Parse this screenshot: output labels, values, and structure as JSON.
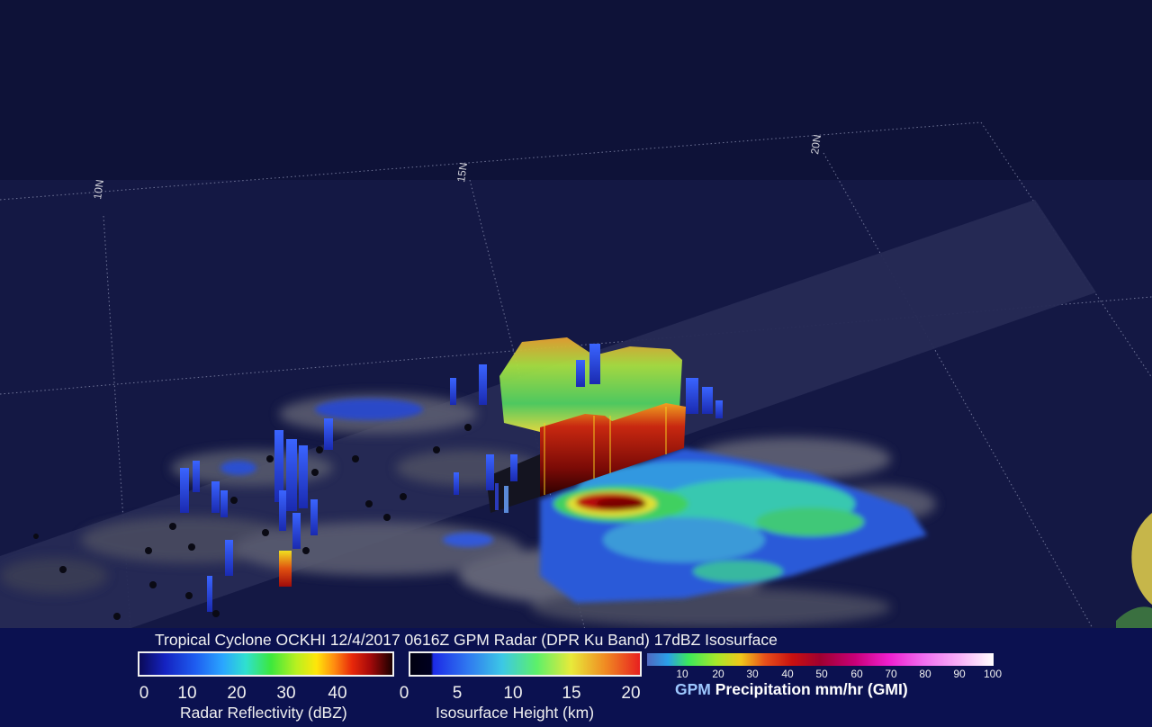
{
  "scene": {
    "latitude_labels": [
      "10N",
      "15N",
      "20N"
    ],
    "surface_colors": {
      "ocean": "#15184a",
      "swath": "#26294f",
      "land": "#c6b64a"
    }
  },
  "legend": {
    "title": "Tropical Cyclone OCKHI 12/4/2017 0616Z GPM Radar (DPR Ku Band) 17dBZ Isosurface",
    "reflectivity": {
      "ticks": [
        "0",
        "10",
        "20",
        "30",
        "40"
      ],
      "label": "Radar Reflectivity (dBZ)"
    },
    "isosurface": {
      "ticks": [
        "0",
        "5",
        "10",
        "15",
        "20"
      ],
      "label": "Isosurface Height (km)"
    },
    "precipitation": {
      "ticks": [
        "10",
        "20",
        "30",
        "40",
        "50",
        "60",
        "70",
        "80",
        "90",
        "100"
      ],
      "label_gpm": "GPM",
      "label_rest": " Precipitation mm/hr (GMI)"
    }
  }
}
